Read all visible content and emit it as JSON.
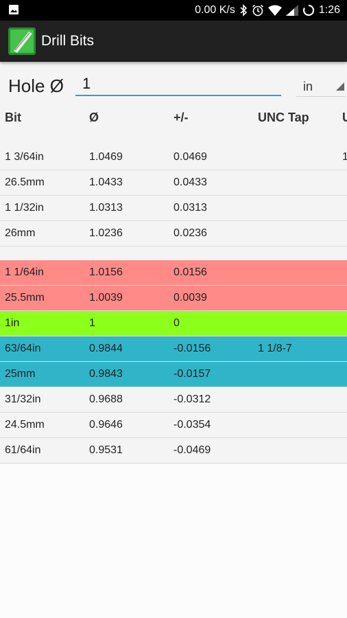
{
  "status_bar": {
    "net_speed": "0.00 K/s",
    "time": "1:26",
    "icons": [
      "image-icon",
      "bluetooth-icon",
      "alarm-icon",
      "wifi-icon",
      "signal-icon",
      "battery-icon"
    ]
  },
  "app": {
    "title": "Drill Bits",
    "icon": "drill-bit-app-icon"
  },
  "hole": {
    "label": "Hole Ø",
    "value": "1",
    "unit": "in"
  },
  "table": {
    "headers": [
      "Bit",
      "Ø",
      "+/-",
      "UNC Tap",
      "U"
    ],
    "rows": [
      {
        "bit": "1 3/64in",
        "dia": "1.0469",
        "diff": "0.0469",
        "unc": "",
        "extra": "1",
        "color": "#f4f4f4"
      },
      {
        "bit": "26.5mm",
        "dia": "1.0433",
        "diff": "0.0433",
        "unc": "",
        "extra": "",
        "color": "#f4f4f4"
      },
      {
        "bit": "1 1/32in",
        "dia": "1.0313",
        "diff": "0.0313",
        "unc": "",
        "extra": "",
        "color": "#f4f4f4"
      },
      {
        "bit": "26mm",
        "dia": "1.0236",
        "diff": "0.0236",
        "unc": "",
        "extra": "",
        "color": "#f4f4f4"
      },
      {
        "bit": "1 1/64in",
        "dia": "1.0156",
        "diff": "0.0156",
        "unc": "",
        "extra": "",
        "color": "#ff8a87"
      },
      {
        "bit": "25.5mm",
        "dia": "1.0039",
        "diff": "0.0039",
        "unc": "",
        "extra": "",
        "color": "#ff8a87"
      },
      {
        "bit": "1in",
        "dia": "1",
        "diff": "0",
        "unc": "",
        "extra": "",
        "color": "#8cff1a"
      },
      {
        "bit": "63/64in",
        "dia": "0.9844",
        "diff": "-0.0156",
        "unc": "1 1/8-7",
        "extra": "",
        "color": "#30b5c8"
      },
      {
        "bit": "25mm",
        "dia": "0.9843",
        "diff": "-0.0157",
        "unc": "",
        "extra": "",
        "color": "#30b5c8"
      },
      {
        "bit": "31/32in",
        "dia": "0.9688",
        "diff": "-0.0312",
        "unc": "",
        "extra": "",
        "color": "#f4f4f4"
      },
      {
        "bit": "24.5mm",
        "dia": "0.9646",
        "diff": "-0.0354",
        "unc": "",
        "extra": "",
        "color": "#f4f4f4"
      },
      {
        "bit": "61/64in",
        "dia": "0.9531",
        "diff": "-0.0469",
        "unc": "",
        "extra": "",
        "color": "#f4f4f4"
      }
    ]
  }
}
